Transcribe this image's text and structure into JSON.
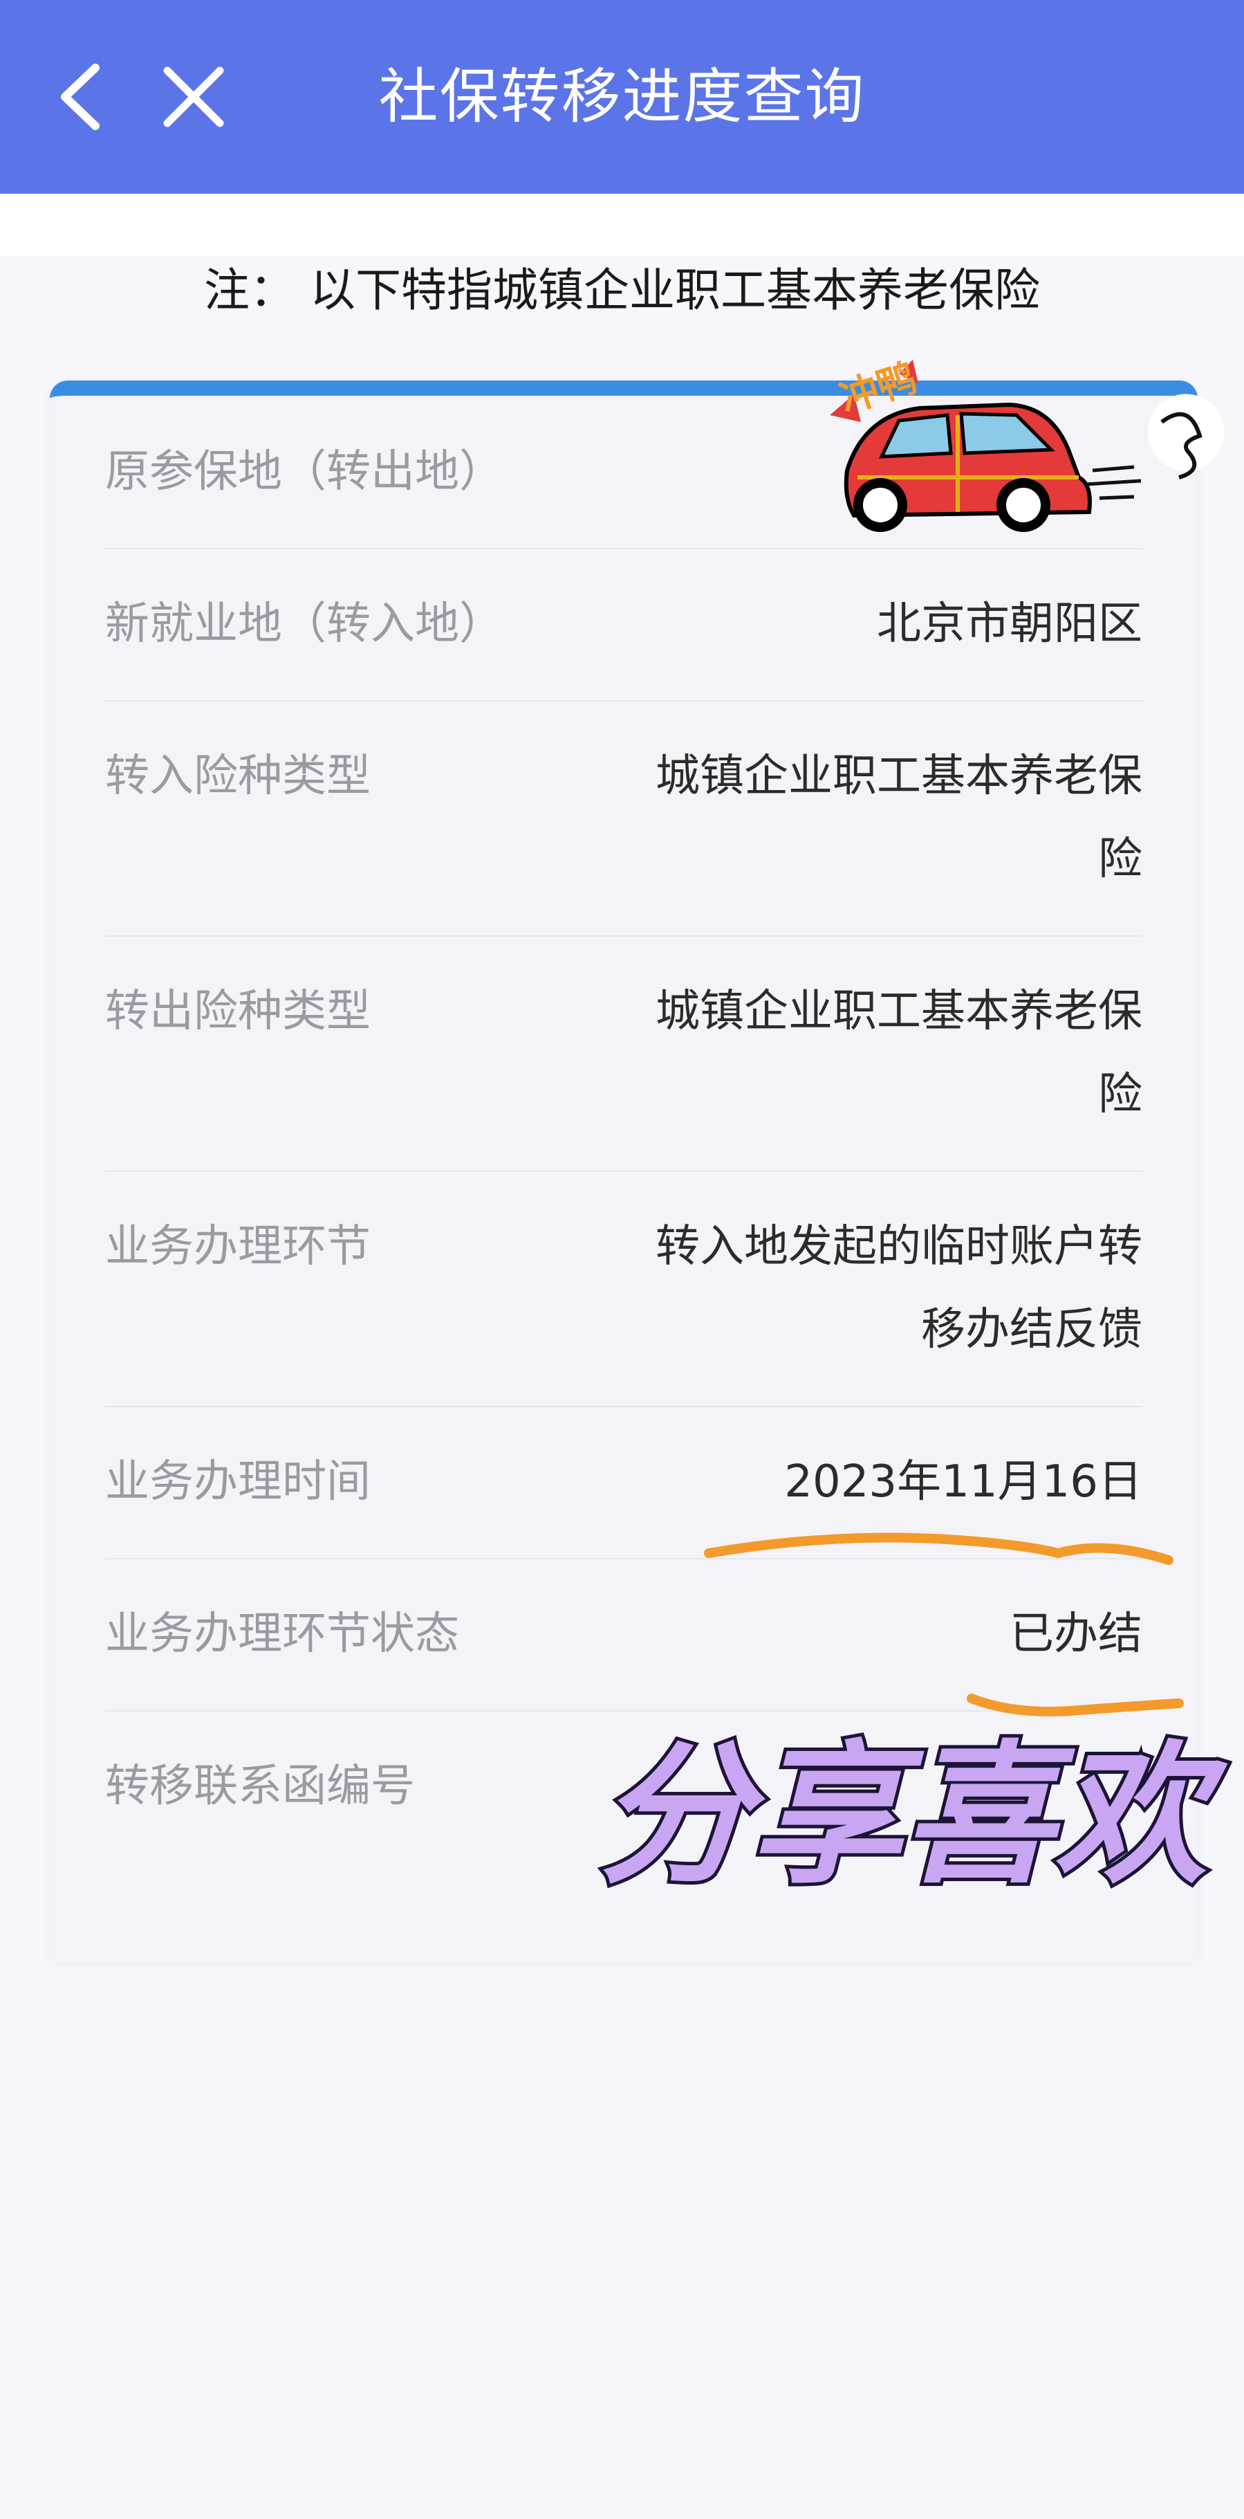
{
  "header": {
    "title": "社保转移进度查询",
    "back_icon": "chevron-left-icon",
    "close_icon": "close-icon",
    "background": "#5b74e8"
  },
  "notice": "注：  以下特指城镇企业职工基本养老保险",
  "card": {
    "accent": "#3a8de3",
    "rows": [
      {
        "label": "原参保地（转出地）",
        "value": ""
      },
      {
        "label": "新就业地（转入地）",
        "value": "北京市朝阳区"
      },
      {
        "label": "转入险种类型",
        "value": "城镇企业职工基本养老保险"
      },
      {
        "label": "转出险种类型",
        "value": "城镇企业职工基本养老保险"
      },
      {
        "label": "业务办理环节",
        "value": "转入地发起的临时账户转移办结反馈"
      },
      {
        "label": "业务办理时间",
        "value": "2023年11月16日"
      },
      {
        "label": "业务办理环节状态",
        "value": "已办结"
      },
      {
        "label": "转移联系函编号",
        "value": ""
      }
    ]
  },
  "stickers": {
    "text_overlay": "分享喜欢",
    "car_badge": "冲鸭",
    "underline_color": "#f39a2c"
  }
}
